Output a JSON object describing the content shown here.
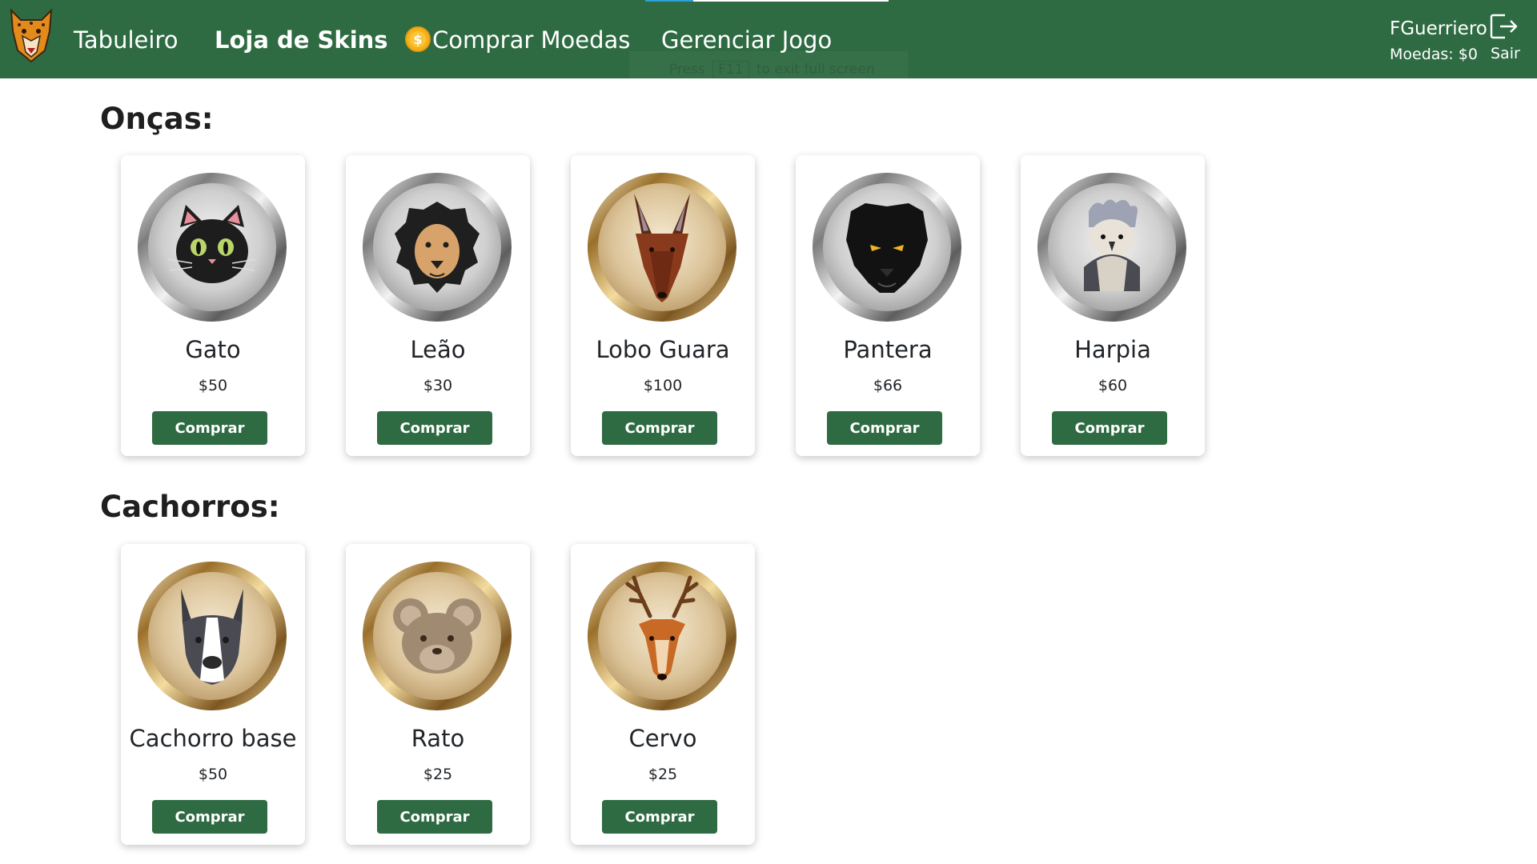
{
  "nav": {
    "logo_icon": "jaguar-logo-icon",
    "links": [
      "Tabuleiro",
      "Loja de Skins",
      "Comprar Moedas",
      "Gerenciar Jogo"
    ],
    "coin_icon": "coin-icon"
  },
  "fullscreen_hint": {
    "prefix": "Press",
    "key": "F11",
    "suffix": "to exit full screen"
  },
  "user": {
    "name": "FGuerriero",
    "coins": "Moedas: $0",
    "logout_label": "Sair",
    "logout_icon": "logout-icon"
  },
  "sections": [
    {
      "title": "Onças:",
      "items": [
        {
          "name": "Gato",
          "price": "$50",
          "button": "Comprar",
          "icon": "cat-icon",
          "frame": "silver"
        },
        {
          "name": "Leão",
          "price": "$30",
          "button": "Comprar",
          "icon": "lion-icon",
          "frame": "silver"
        },
        {
          "name": "Lobo Guara",
          "price": "$100",
          "button": "Comprar",
          "icon": "maned-wolf-icon",
          "frame": "gold"
        },
        {
          "name": "Pantera",
          "price": "$66",
          "button": "Comprar",
          "icon": "panther-icon",
          "frame": "silver"
        },
        {
          "name": "Harpia",
          "price": "$60",
          "button": "Comprar",
          "icon": "harpy-eagle-icon",
          "frame": "silver"
        }
      ]
    },
    {
      "title": "Cachorros:",
      "items": [
        {
          "name": "Cachorro base",
          "price": "$50",
          "button": "Comprar",
          "icon": "dog-icon",
          "frame": "gold"
        },
        {
          "name": "Rato",
          "price": "$25",
          "button": "Comprar",
          "icon": "rat-icon",
          "frame": "gold"
        },
        {
          "name": "Cervo",
          "price": "$25",
          "button": "Comprar",
          "icon": "deer-icon",
          "frame": "gold"
        }
      ]
    }
  ],
  "colors": {
    "primary": "#2e6b42",
    "silver_frame": "#c0c0c0",
    "gold_frame": "#c9a35a"
  }
}
